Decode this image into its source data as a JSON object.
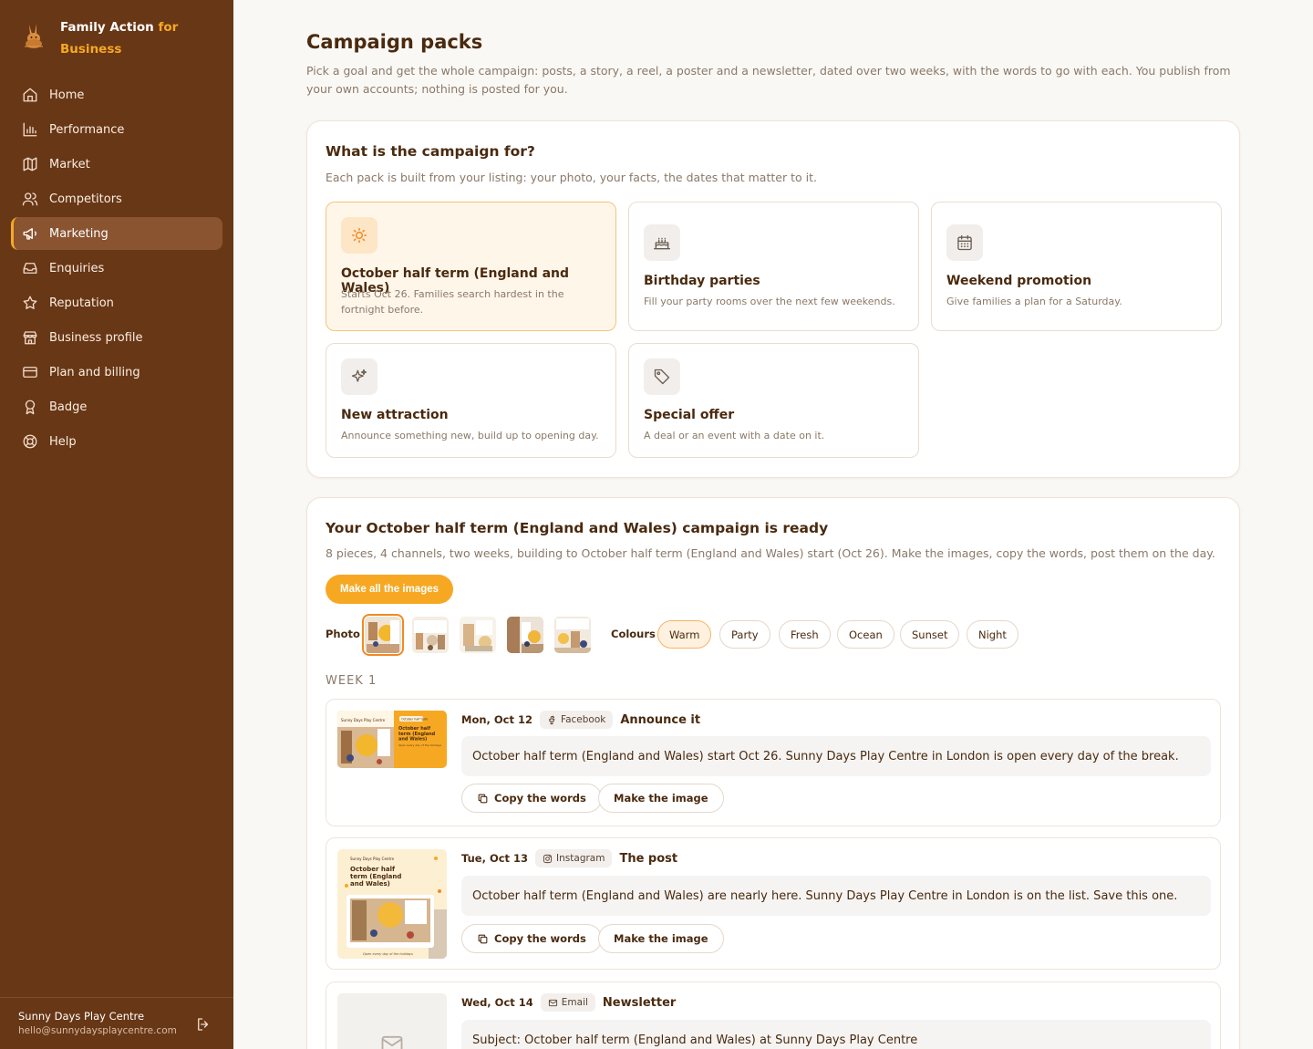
{
  "brand": {
    "name_part1": "Family Action",
    "name_part2": "for",
    "name_part3": "Business"
  },
  "nav": [
    {
      "label": "Home",
      "icon": "home-icon"
    },
    {
      "label": "Performance",
      "icon": "bar-chart-icon"
    },
    {
      "label": "Market",
      "icon": "map-icon"
    },
    {
      "label": "Competitors",
      "icon": "users-icon"
    },
    {
      "label": "Marketing",
      "icon": "megaphone-icon",
      "active": true
    },
    {
      "label": "Enquiries",
      "icon": "inbox-icon"
    },
    {
      "label": "Reputation",
      "icon": "star-icon"
    },
    {
      "label": "Business profile",
      "icon": "store-icon"
    },
    {
      "label": "Plan and billing",
      "icon": "credit-card-icon"
    },
    {
      "label": "Badge",
      "icon": "award-icon"
    },
    {
      "label": "Help",
      "icon": "lifebuoy-icon"
    }
  ],
  "account": {
    "name": "Sunny Days Play Centre",
    "email": "hello@sunnydaysplaycentre.com"
  },
  "page": {
    "title": "Campaign packs",
    "description": "Pick a goal and get the whole campaign: posts, a story, a reel, a poster and a newsletter, dated over two weeks, with the words to go with each. You publish from your own accounts; nothing is posted for you."
  },
  "goals_section": {
    "title": "What is the campaign for?",
    "subtitle": "Each pack is built from your listing: your photo, your facts, the dates that matter to it.",
    "goals": [
      {
        "title": "October half term (England and Wales)",
        "description": "Starts Oct 26. Families search hardest in the fortnight before.",
        "icon": "sun-icon",
        "selected": true
      },
      {
        "title": "Birthday parties",
        "description": "Fill your party rooms over the next few weekends.",
        "icon": "cake-icon"
      },
      {
        "title": "Weekend promotion",
        "description": "Give families a plan for a Saturday.",
        "icon": "calendar-icon"
      },
      {
        "title": "New attraction",
        "description": "Announce something new, build up to opening day.",
        "icon": "sparkles-icon"
      },
      {
        "title": "Special offer",
        "description": "A deal or an event with a date on it.",
        "icon": "tag-icon"
      }
    ]
  },
  "campaign": {
    "title": "Your October half term (England and Wales) campaign is ready",
    "subtitle": "8 pieces, 4 channels, two weeks, building to October half term (England and Wales) start (Oct 26). Make the images, copy the words, post them on the day.",
    "make_all_label": "Make all the images",
    "photo_label": "Photo",
    "colours_label": "Colours",
    "colours": [
      "Warm",
      "Party",
      "Fresh",
      "Ocean",
      "Sunset",
      "Night"
    ],
    "selected_colour": "Warm",
    "selected_photo_index": 0,
    "week_label": "WEEK 1",
    "copy_label": "Copy the words",
    "make_label": "Make the image",
    "pieces": [
      {
        "date": "Mon, Oct 12",
        "channel": "Facebook",
        "kind": "Announce it",
        "text": "October half term (England and Wales) start Oct 26. Sunny Days Play Centre in London is open every day of the break."
      },
      {
        "date": "Tue, Oct 13",
        "channel": "Instagram",
        "kind": "The post",
        "text": "October half term (England and Wales) are nearly here. Sunny Days Play Centre in London is on the list. Save this one."
      },
      {
        "date": "Wed, Oct 14",
        "channel": "Email",
        "kind": "Newsletter",
        "text": "Subject: October half term (England and Wales) at Sunny Days Play Centre"
      }
    ]
  },
  "previews": {
    "fb_header": "Sunny Days Play Centre",
    "fb_tag": "October half term",
    "fb_title": "October half term (England and Wales)",
    "fb_foot": "Open every day of the holidays",
    "ig_header": "Sunny Days Play Centre",
    "ig_title": "October half term (England and Wales)",
    "ig_foot": "Open every day of the holidays"
  },
  "colors": {
    "sidebar": "#683716",
    "accent": "#f7a823",
    "text": "#4a2a0f"
  }
}
